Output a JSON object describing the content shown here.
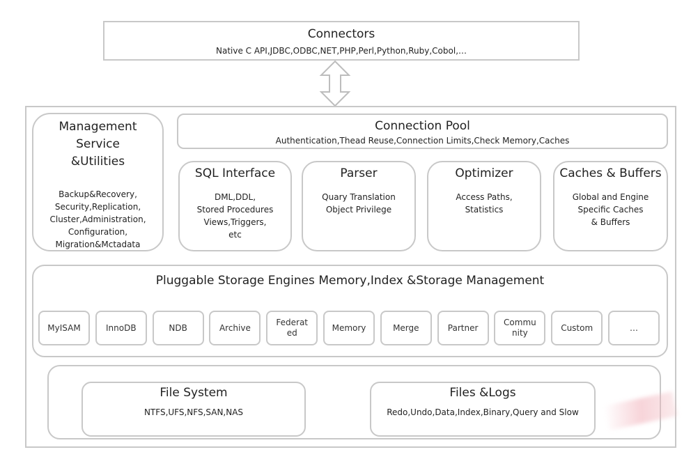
{
  "connectors": {
    "title": "Connectors",
    "subtitle": "Native C API,JDBC,ODBC,NET,PHP,Perl,Python,Ruby,Cobol,…"
  },
  "management": {
    "title_lines": [
      "Management",
      "Service",
      "&Utilities"
    ],
    "items": [
      "Backup&Recovery,",
      "Security,Replication,",
      "Cluster,Administration,",
      "Configuration,",
      "Migration&Mctadata"
    ]
  },
  "connection_pool": {
    "title": "Connection Pool",
    "subtitle": "Authentication,Thead Reuse,Connection Limits,Check Memory,Caches"
  },
  "modules": [
    {
      "title": "SQL Interface",
      "lines": [
        "DML,DDL,",
        "Stored Procedures",
        "Views,Triggers,",
        "etc"
      ]
    },
    {
      "title": "Parser",
      "lines": [
        "Quary Translation",
        "Object Privilege"
      ]
    },
    {
      "title": "Optimizer",
      "lines": [
        "Access Paths,",
        "Statistics"
      ]
    },
    {
      "title": "Caches & Buffers",
      "lines": [
        "Global and Engine",
        "Specific Caches",
        "& Buffers"
      ]
    }
  ],
  "storage": {
    "title": "Pluggable Storage Engines Memory,Index &Storage Management",
    "engines": [
      "MyISAM",
      "InnoDB",
      "NDB",
      "Archive",
      "Federat\ned",
      "Memory",
      "Merge",
      "Partner",
      "Commu\nnity",
      "Custom",
      "…"
    ]
  },
  "file_system": {
    "title": "File System",
    "subtitle": "NTFS,UFS,NFS,SAN,NAS"
  },
  "files_logs": {
    "title": "Files &Logs",
    "subtitle": "Redo,Undo,Data,Index,Binary,Query and Slow"
  },
  "colors": {
    "border": "#c8c8c8",
    "text": "#222222"
  }
}
